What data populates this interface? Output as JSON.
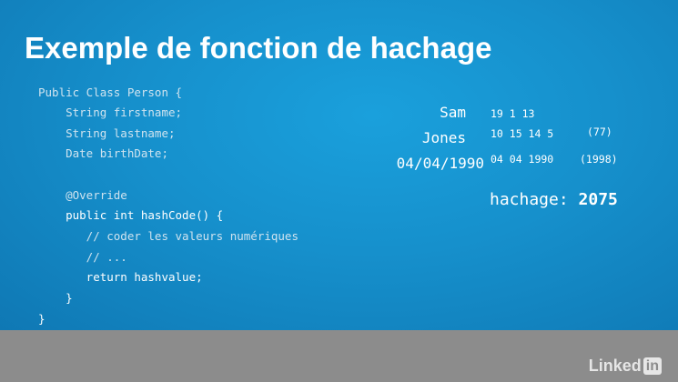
{
  "slide": {
    "title": "Exemple de fonction de hachage",
    "code_lines": [
      "Public Class Person {",
      "    String firstname;",
      "    String lastname;",
      "    Date birthDate;",
      "",
      "    @Override",
      "    public int hashCode() {",
      "       // coder les valeurs numériques",
      "       // ...",
      "       return hashvalue;",
      "    }",
      "}"
    ],
    "fields": [
      {
        "value": "Sam",
        "encoding": "19 1 13",
        "sum": ""
      },
      {
        "value": "Jones",
        "encoding": "10 15 14 5",
        "sum": "(77)"
      },
      {
        "value": "04/04/1990",
        "encoding": "04 04 1990",
        "sum": "(1998)"
      }
    ],
    "hash_label": "hachage:",
    "hash_value": "2075"
  },
  "branding": {
    "logo_text": "Linked",
    "logo_badge": "in"
  },
  "colors": {
    "slide_bg": "#1690cc",
    "text": "#ffffff",
    "band": "#8c8c8c"
  }
}
